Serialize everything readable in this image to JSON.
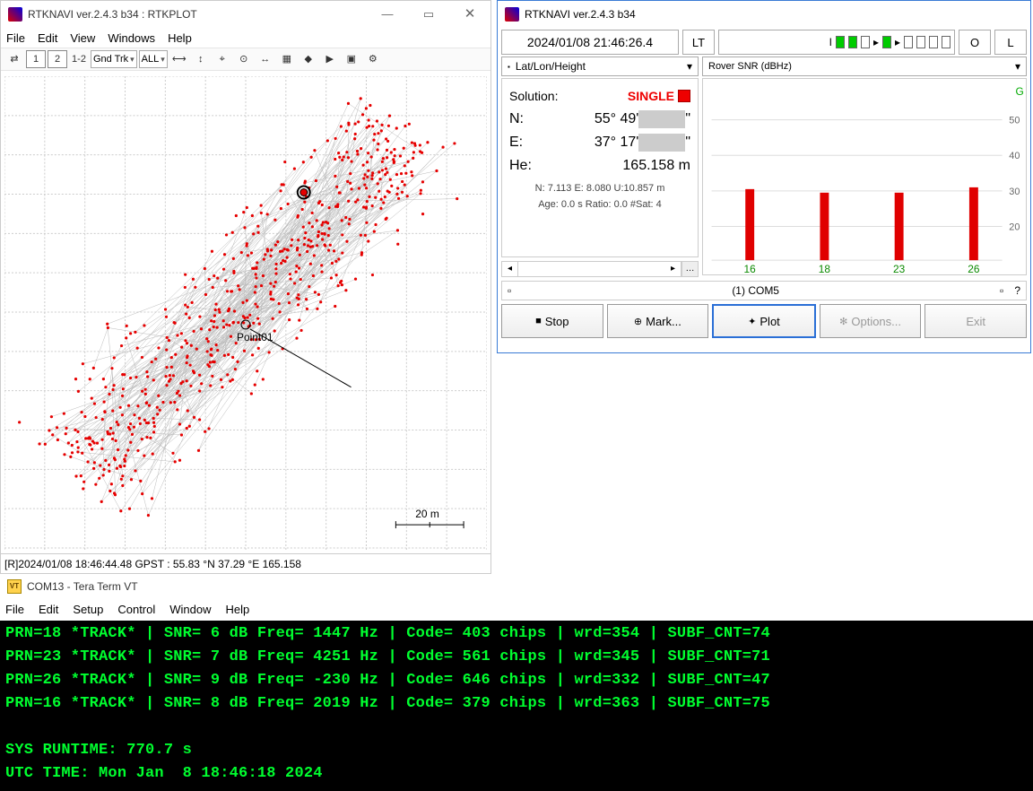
{
  "rtkplot": {
    "title": "RTKNAVI ver.2.4.3 b34 : RTKPLOT",
    "menu": [
      "File",
      "Edit",
      "View",
      "Windows",
      "Help"
    ],
    "toolbar": {
      "btn_connect": "⇄",
      "btn_1": "1",
      "btn_2": "2",
      "btn_12": "1-2",
      "sel_trk": "Gnd Trk",
      "sel_all": "ALL"
    },
    "point_label": "Point01",
    "scale_label": "20 m",
    "status": "[R]2024/01/08 18:46:44.48 GPST :  55.83            °N  37.29            °E  165.158"
  },
  "rtknavi": {
    "title": "RTKNAVI ver.2.4.3 b34",
    "time": "2024/01/08 21:46:26.4",
    "lt": "LT",
    "stream_I": "I",
    "stream_O": "O",
    "stream_L": "L",
    "sel_left_blank": "▪",
    "sel_left": "Lat/Lon/Height",
    "sel_left_arrow": "▾",
    "sel_right": "Rover  SNR (dBHz)",
    "sel_right_arrow": "▾",
    "sol": {
      "label": "Solution:",
      "status": "SINGLE",
      "n_label": "N:",
      "n_val_prefix": "55° 49'",
      "n_val_suffix": "\"",
      "e_label": "E:",
      "e_val_prefix": "37° 17'",
      "e_val_suffix": "\"",
      "he_label": "He:",
      "he_val": "165.158 m",
      "neu": "N: 7.113 E: 8.080 U:10.857 m",
      "age": "Age: 0.0 s Ratio: 0.0 #Sat: 4"
    },
    "snr_G": "G",
    "status2_port": "(1) COM5",
    "status2_q": "?",
    "btn_stop": "Stop",
    "btn_mark": "Mark...",
    "btn_plot": "Plot",
    "btn_opts": "Options...",
    "btn_exit": "Exit"
  },
  "term": {
    "title": "COM13 - Tera Term VT",
    "menu": [
      "File",
      "Edit",
      "Setup",
      "Control",
      "Window",
      "Help"
    ],
    "lines": [
      "PRN=18 *TRACK* | SNR= 6 dB Freq= 1447 Hz | Code= 403 chips | wrd=354 | SUBF_CNT=74",
      "PRN=23 *TRACK* | SNR= 7 dB Freq= 4251 Hz | Code= 561 chips | wrd=345 | SUBF_CNT=71",
      "PRN=26 *TRACK* | SNR= 9 dB Freq= -230 Hz | Code= 646 chips | wrd=332 | SUBF_CNT=47",
      "PRN=16 *TRACK* | SNR= 8 dB Freq= 2019 Hz | Code= 379 chips | wrd=363 | SUBF_CNT=75",
      "",
      "SYS RUNTIME: 770.7 s",
      "UTC TIME: Mon Jan  8 18:46:18 2024"
    ]
  },
  "chart_data": [
    {
      "type": "scatter",
      "title": "Ground Track",
      "units": "m",
      "note": "Dense point cloud with connecting grey lines; approximate extent along NE–SW diagonal. Point markers in red; Point01 annotated near centre; reference circle near upper cluster.",
      "x_range_m": [
        -100,
        130
      ],
      "y_range_m": [
        -140,
        130
      ],
      "scale_bar_m": 20,
      "reference_marker": {
        "x_m": 40,
        "y_m": 70
      },
      "annotation": {
        "name": "Point01",
        "x_m": 10,
        "y_m": -5
      }
    },
    {
      "type": "bar",
      "title": "Rover SNR (dBHz)",
      "ylabel": "SNR (dBHz)",
      "ylim": [
        0,
        55
      ],
      "yticks": [
        20,
        30,
        40,
        50
      ],
      "categories": [
        "16",
        "18",
        "23",
        "26"
      ],
      "values": [
        27,
        26,
        26,
        28
      ],
      "series_color": "#e00000",
      "constellation": "G"
    }
  ]
}
